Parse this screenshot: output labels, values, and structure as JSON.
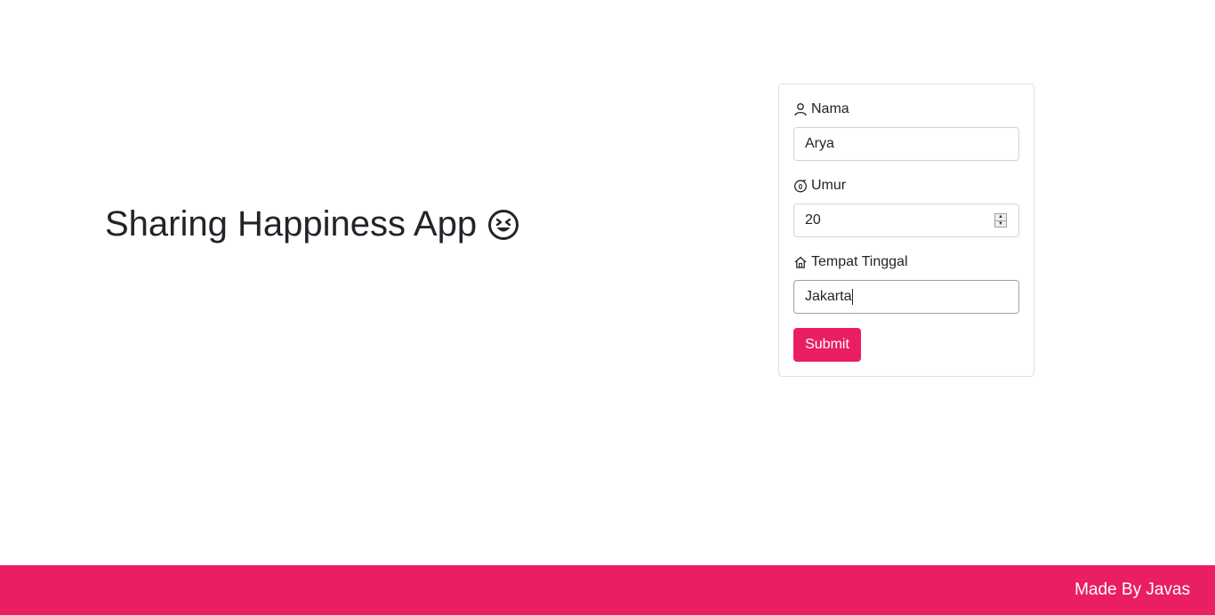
{
  "hero": {
    "title": "Sharing Happiness App",
    "emoji_icon": "grinning-squinting-face-icon"
  },
  "form": {
    "nama": {
      "label": "Nama",
      "icon": "person-icon",
      "value": "Arya"
    },
    "umur": {
      "label": "Umur",
      "icon": "age-icon",
      "value": "20"
    },
    "tempat_tinggal": {
      "label": "Tempat Tinggal",
      "icon": "home-icon",
      "value": "Jakarta"
    },
    "submit_label": "Submit"
  },
  "footer": {
    "text": "Made By Javas"
  },
  "colors": {
    "accent": "#e91e63",
    "text": "#212529",
    "border": "#ced4da"
  }
}
